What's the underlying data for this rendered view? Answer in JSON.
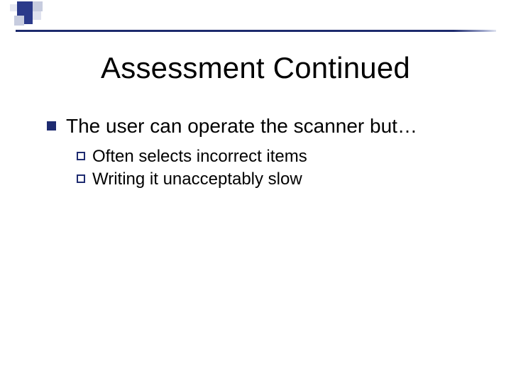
{
  "title": "Assessment Continued",
  "bullets": {
    "level1": {
      "text": "The user can operate the scanner but…"
    },
    "level2": [
      {
        "text": "Often selects incorrect items"
      },
      {
        "text": "Writing it unacceptably slow"
      }
    ]
  },
  "theme": {
    "accent": "#1e2b70",
    "ruleColor": "#1d2a6d"
  }
}
